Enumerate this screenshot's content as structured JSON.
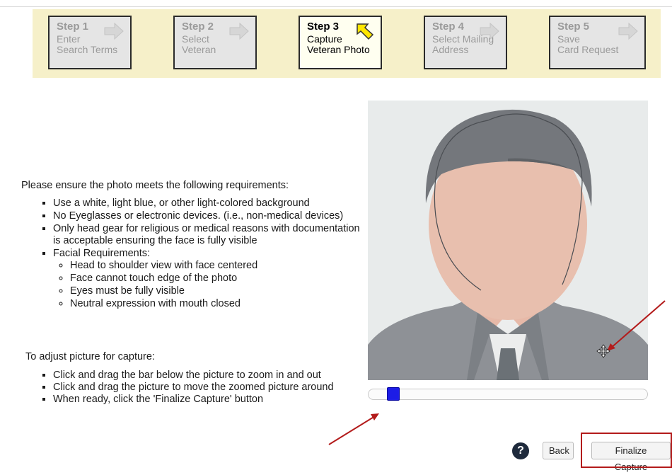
{
  "steps": [
    {
      "number": "Step 1",
      "line1": "Enter",
      "line2": "Search Terms"
    },
    {
      "number": "Step 2",
      "line1": "Select",
      "line2": "Veteran"
    },
    {
      "number": "Step 3",
      "line1": "Capture",
      "line2": "Veteran Photo"
    },
    {
      "number": "Step 4",
      "line1": "Select Mailing",
      "line2": "Address"
    },
    {
      "number": "Step 5",
      "line1": "Save",
      "line2": "Card Request"
    }
  ],
  "requirements": {
    "intro": "Please ensure the photo meets the following requirements:",
    "items": [
      "Use a white, light blue, or other light-colored background",
      "No Eyeglasses or electronic devices. (i.e., non-medical devices)",
      "Only head gear for religious or medical reasons with documentation is acceptable ensuring the face is fully visible",
      "Facial Requirements:"
    ],
    "facial": [
      "Head to shoulder view with face centered",
      "Face cannot touch edge of the photo",
      "Eyes must be fully visible",
      "Neutral expression with mouth closed"
    ]
  },
  "adjust": {
    "intro": "To adjust picture for capture:",
    "items": [
      "Click and drag the bar below the picture to zoom in and out",
      "Click and drag the picture to move the zoomed picture around",
      "When ready, click the 'Finalize Capture' button"
    ]
  },
  "zoom": {
    "level": 0.09
  },
  "buttons": {
    "help": "?",
    "back": "Back",
    "finalize": "Finalize Capture"
  },
  "icons": {
    "step_arrow": "right-arrow-icon",
    "active_step": "pointer-arrow-icon",
    "help": "question-icon",
    "move_cursor": "move-cursor-icon"
  },
  "colors": {
    "steps_bg": "#f6f0c9",
    "slider_handle": "#1c1ce6",
    "highlight": "#b31b1b",
    "annotation_arrow": "#b31b1b"
  }
}
